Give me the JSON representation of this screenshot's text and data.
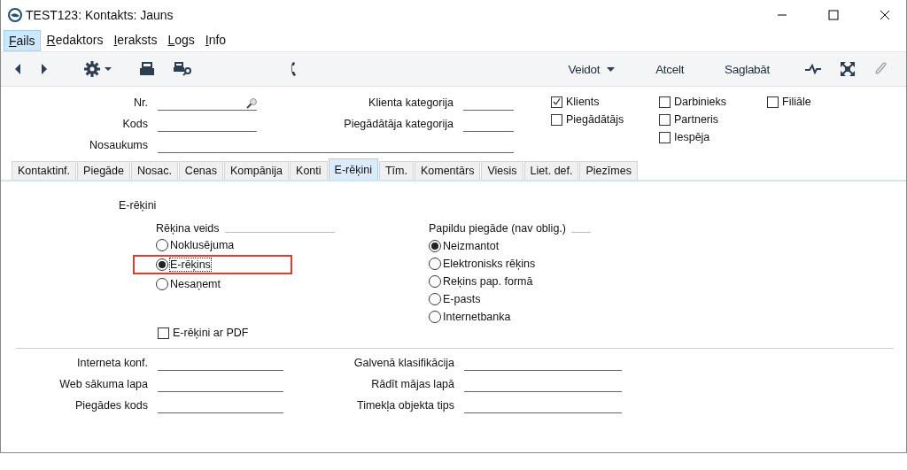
{
  "window": {
    "title": "TEST123: Kontakts: Jauns"
  },
  "menu": [
    {
      "label": "Fails",
      "selected": true
    },
    {
      "label": "Redaktors",
      "selected": false
    },
    {
      "label": "Ieraksts",
      "selected": false
    },
    {
      "label": "Logs",
      "selected": false
    },
    {
      "label": "Info",
      "selected": false
    }
  ],
  "toolbar": {
    "buttons": [
      {
        "label": "Veidot",
        "dropdown": true
      },
      {
        "label": "Atcelt",
        "dropdown": false
      },
      {
        "label": "Saglabāt",
        "dropdown": false
      }
    ]
  },
  "left_fields": [
    {
      "label": "Nr.",
      "kind": "lookup"
    },
    {
      "label": "Kods",
      "kind": "plain"
    },
    {
      "label": "Nosaukums",
      "kind": "wide"
    }
  ],
  "category_fields": [
    "Klienta kategorija",
    "Piegādātāja kategorija"
  ],
  "roles": [
    [
      {
        "label": "Klients",
        "checked": true
      },
      {
        "label": "Piegādātājs",
        "checked": false
      }
    ],
    [
      {
        "label": "Darbinieks",
        "checked": false
      },
      {
        "label": "Partneris",
        "checked": false
      },
      {
        "label": "Iespēja",
        "checked": false
      }
    ],
    [
      {
        "label": "Filiāle",
        "checked": false
      }
    ]
  ],
  "tabs": [
    {
      "label": "Kontaktinf.",
      "selected": false
    },
    {
      "label": "Piegāde",
      "selected": false
    },
    {
      "label": "Nosac.",
      "selected": false
    },
    {
      "label": "Cenas",
      "selected": false
    },
    {
      "label": "Kompānija",
      "selected": false
    },
    {
      "label": "Konti",
      "selected": false
    },
    {
      "label": "E-rēķini",
      "selected": true
    },
    {
      "label": "Tīm.",
      "selected": false
    },
    {
      "label": "Komentārs",
      "selected": false
    },
    {
      "label": "Viesis",
      "selected": false
    },
    {
      "label": "Liet. def.",
      "selected": false
    },
    {
      "label": "Piezīmes",
      "selected": false
    }
  ],
  "section_title": "E-rēķini",
  "invoice_type": {
    "title": "Rēķina veids",
    "options": [
      {
        "label": "Noklusējuma",
        "selected": false,
        "highlighted": false
      },
      {
        "label": "E-rēķins",
        "selected": true,
        "highlighted": true
      },
      {
        "label": "Nesaņemt",
        "selected": false,
        "highlighted": false
      }
    ]
  },
  "extra_delivery": {
    "title": "Papildu piegāde (nav oblig.)",
    "options": [
      {
        "label": "Neizmantot",
        "selected": true
      },
      {
        "label": "Elektronisks rēķins",
        "selected": false
      },
      {
        "label": "Reķins pap. formā",
        "selected": false
      },
      {
        "label": "E-pasts",
        "selected": false
      },
      {
        "label": "Internetbanka",
        "selected": false
      }
    ]
  },
  "pdf_option": {
    "label": "E-rēķini ar PDF",
    "checked": false
  },
  "bottom_fields": [
    [
      "Interneta konf.",
      "Web sākuma lapa",
      "Piegādes kods"
    ],
    [
      "Galvenā klasifikācija",
      "Rādīt mājas lapā",
      "Timekļa objekta tips"
    ]
  ]
}
